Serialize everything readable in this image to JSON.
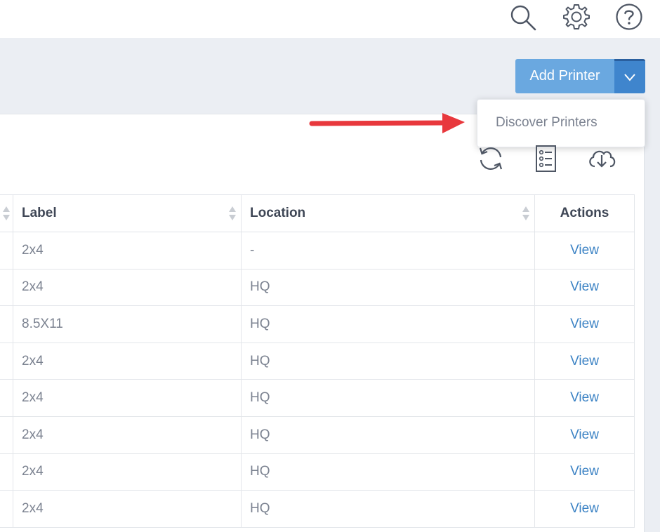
{
  "topbar": {
    "icons": [
      "search-icon",
      "gear-icon",
      "help-icon"
    ]
  },
  "actions": {
    "add_printer_label": "Add Printer",
    "dropdown_items": [
      "Discover Printers"
    ]
  },
  "toolbar": {
    "icons": [
      "refresh-icon",
      "checklist-icon",
      "cloud-download-icon"
    ]
  },
  "table": {
    "columns": [
      "Label",
      "Location",
      "Actions"
    ],
    "rows": [
      {
        "label": "2x4",
        "location": "-",
        "action": "View"
      },
      {
        "label": "2x4",
        "location": "HQ",
        "action": "View"
      },
      {
        "label": "8.5X11",
        "location": "HQ",
        "action": "View"
      },
      {
        "label": "2x4",
        "location": "HQ",
        "action": "View"
      },
      {
        "label": "2x4",
        "location": "HQ",
        "action": "View"
      },
      {
        "label": "2x4",
        "location": "HQ",
        "action": "View"
      },
      {
        "label": "2x4",
        "location": "HQ",
        "action": "View"
      },
      {
        "label": "2x4",
        "location": "HQ",
        "action": "View"
      }
    ]
  },
  "colors": {
    "accent": "#3f85cd",
    "accent_light": "#6aa8e0",
    "link": "#3b82c4",
    "annotation_arrow": "#e8383d",
    "background": "#ebeef3"
  }
}
